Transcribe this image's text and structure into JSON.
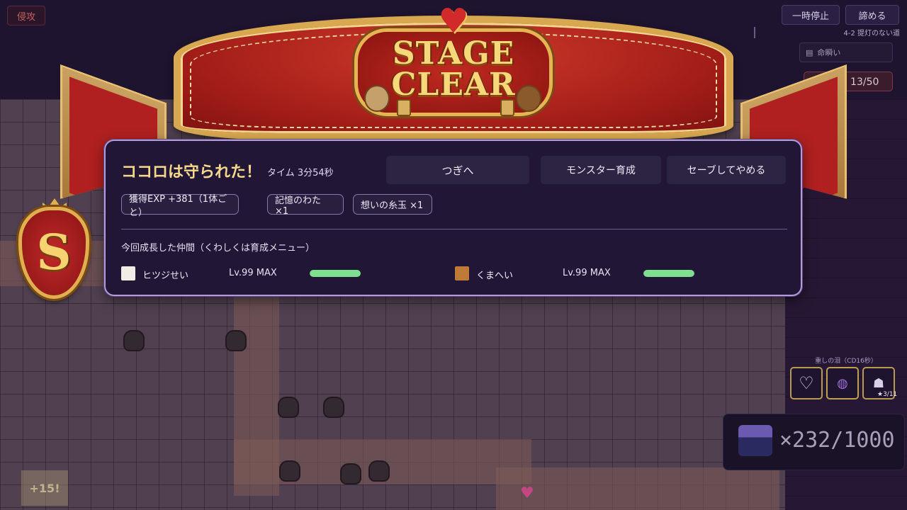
{
  "hud": {
    "invade_tag": "侵攻",
    "pause_label": "一時停止",
    "giveup_label": "諦める",
    "stage_label": "4-2  提灯のない道",
    "map_name": "命瞬い",
    "party_count": "なかま 13/50"
  },
  "banner": {
    "line1": "STAGE",
    "line2": "CLEAR"
  },
  "rank": "S",
  "result": {
    "title": "ココロは守られた！",
    "time": "タイム  3分54秒",
    "buttons": {
      "next": "つぎへ",
      "train": "モンスター育成",
      "save_quit": "セーブしてやめる"
    },
    "rewards": [
      {
        "label": "獲得EXP  +381（1体ごと）"
      },
      {
        "label": "記憶のわた ×1"
      },
      {
        "label": "想いの糸玉 ×1"
      }
    ],
    "section_label": "今回成長した仲間（くわしくは育成メニュー）",
    "allies": [
      {
        "name": "ヒツジせい",
        "level": "Lv.99  MAX",
        "color": "#f2ece6",
        "progress": 1.0
      },
      {
        "name": "くまへい",
        "level": "Lv.99  MAX",
        "color": "#c07a38",
        "progress": 1.0
      }
    ]
  },
  "side": {
    "skill_label": "重しの泪（CD16秒）",
    "slot_count": "★3/11",
    "counter": "×232/1000",
    "exp_float": "+15!"
  },
  "colors": {
    "panel_border": "#b49ad8",
    "title_gold": "#f5d88a",
    "bar_green": "#7ee08e",
    "ribbon_red": "#b02020"
  }
}
